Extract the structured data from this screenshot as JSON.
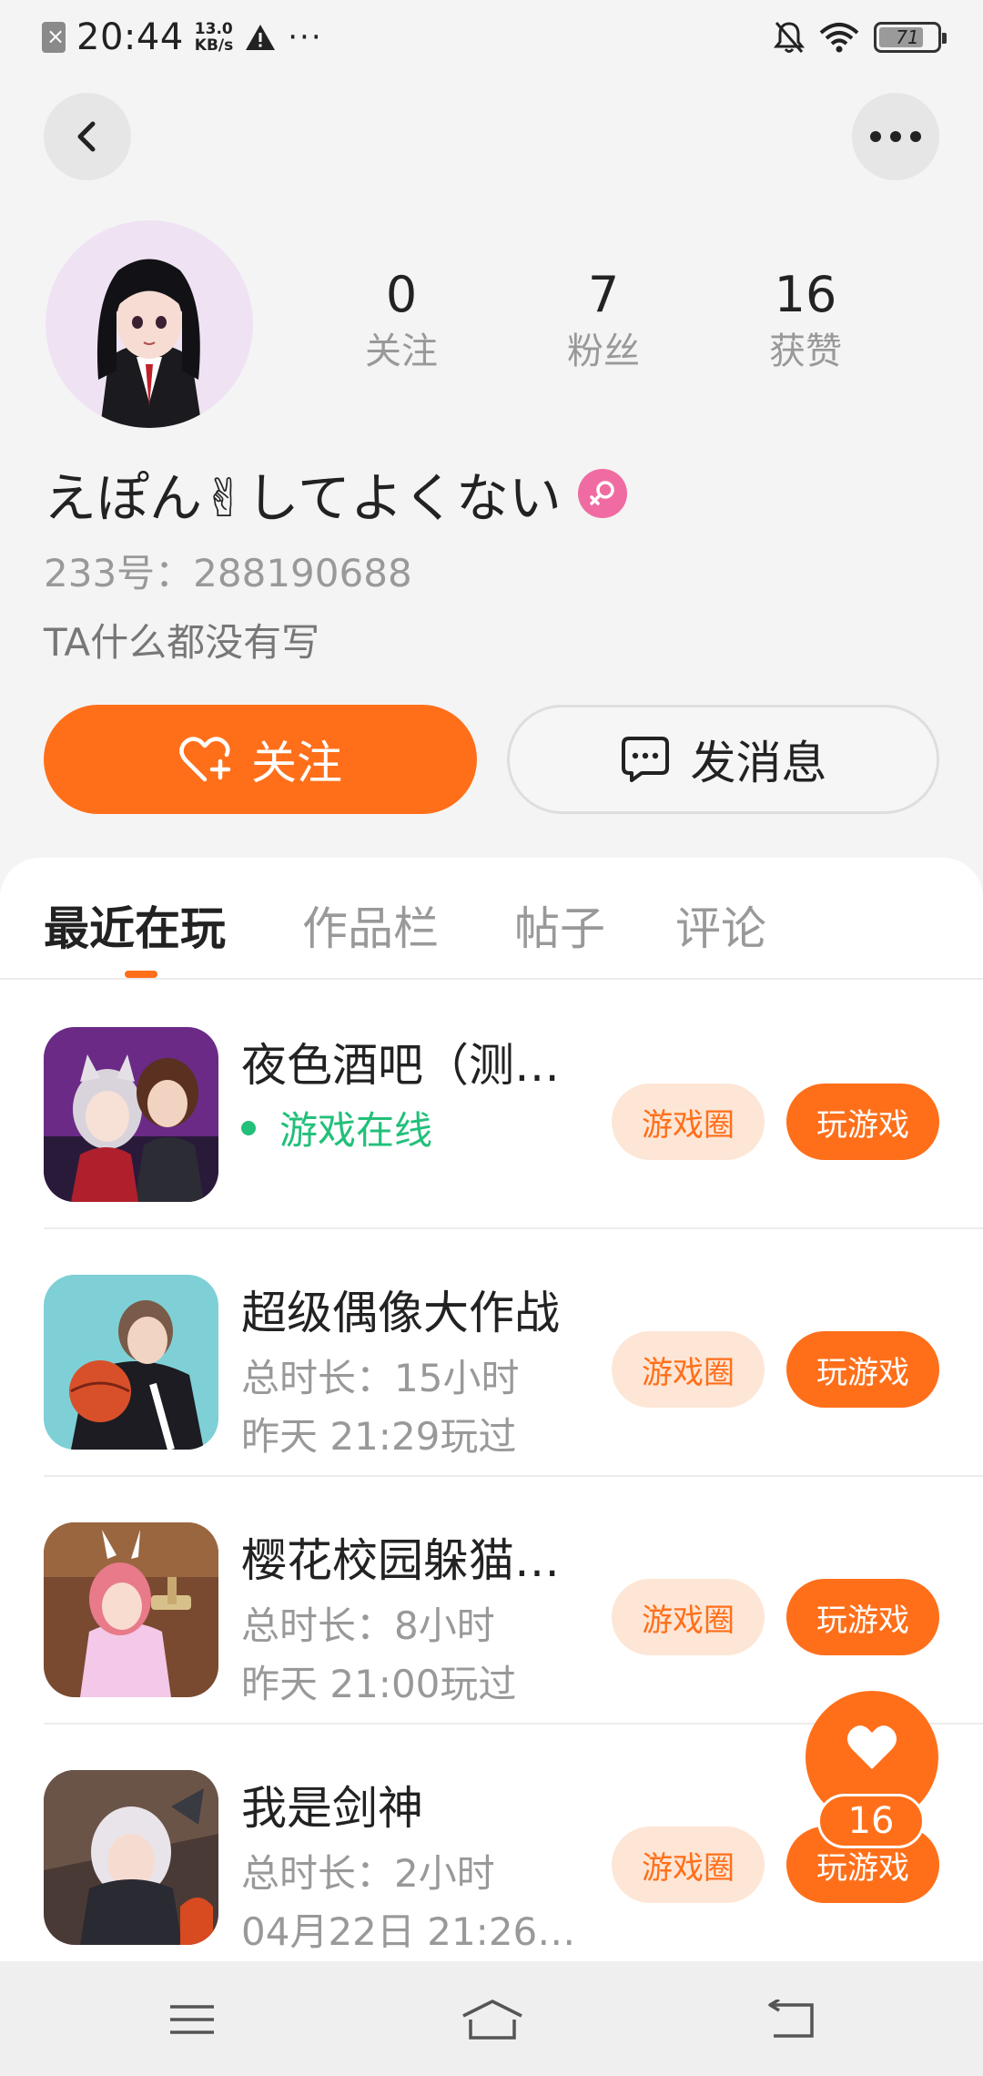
{
  "status_bar": {
    "time": "20:44",
    "speed_value": "13.0",
    "speed_unit": "KB/s",
    "more_indicator": "···",
    "battery_level": "71"
  },
  "icons": {
    "back": "chevron-left-icon",
    "more": "more-horizontal-icon",
    "gender": "female-icon",
    "follow": "heart-plus-icon",
    "message": "chat-bubble-icon",
    "like": "heart-icon",
    "nav_menu": "menu-icon",
    "nav_home": "home-icon",
    "nav_back": "back-arrow-icon"
  },
  "colors": {
    "accent": "#ff6f1a",
    "online": "#22c07a",
    "gender_badge": "#f06ba2"
  },
  "profile": {
    "stats": [
      {
        "value": "0",
        "label": "关注"
      },
      {
        "value": "7",
        "label": "粉丝"
      },
      {
        "value": "16",
        "label": "获赞"
      }
    ],
    "nickname": "えぽん✌してよくない",
    "uid": "233号：288190688",
    "bio": "TA什么都没有写",
    "follow_label": "关注",
    "message_label": "发消息"
  },
  "tabs": [
    {
      "label": "最近在玩",
      "active": true
    },
    {
      "label": "作品栏",
      "active": false
    },
    {
      "label": "帖子",
      "active": false
    },
    {
      "label": "评论",
      "active": false
    }
  ],
  "games": [
    {
      "title": "夜色酒吧（测…",
      "status": "游戏在线",
      "circle_label": "游戏圈",
      "play_label": "玩游戏"
    },
    {
      "title": "超级偶像大作战",
      "duration": "总时长：15小时",
      "last_played": "昨天 21:29玩过",
      "circle_label": "游戏圈",
      "play_label": "玩游戏"
    },
    {
      "title": "樱花校园躲猫…",
      "duration": "总时长：8小时",
      "last_played": "昨天 21:00玩过",
      "circle_label": "游戏圈",
      "play_label": "玩游戏"
    },
    {
      "title": "我是剑神",
      "duration": "总时长：2小时",
      "last_played": "04月22日 21:26…",
      "circle_label": "游戏圈",
      "play_label": "玩游戏"
    }
  ],
  "like_count": "16"
}
